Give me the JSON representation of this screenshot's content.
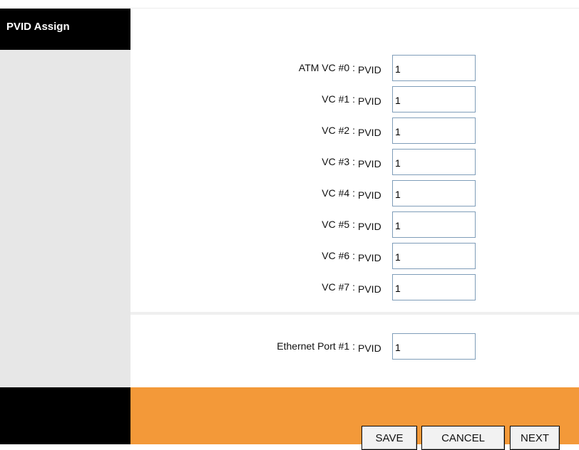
{
  "sidebar": {
    "title": "PVID Assign"
  },
  "vc_rows": [
    {
      "label": "ATM VC #0 :",
      "pvid_label": "PVID",
      "value": "1"
    },
    {
      "label": "VC #1 :",
      "pvid_label": "PVID",
      "value": "1"
    },
    {
      "label": "VC #2 :",
      "pvid_label": "PVID",
      "value": "1"
    },
    {
      "label": "VC #3 :",
      "pvid_label": "PVID",
      "value": "1"
    },
    {
      "label": "VC #4 :",
      "pvid_label": "PVID",
      "value": "1"
    },
    {
      "label": "VC #5 :",
      "pvid_label": "PVID",
      "value": "1"
    },
    {
      "label": "VC #6 :",
      "pvid_label": "PVID",
      "value": "1"
    },
    {
      "label": "VC #7 :",
      "pvid_label": "PVID",
      "value": "1"
    }
  ],
  "ethernet": {
    "label": "Ethernet Port #1 :",
    "pvid_label": "PVID",
    "value": "1"
  },
  "buttons": {
    "save": "SAVE",
    "cancel": "CANCEL",
    "next": "NEXT"
  },
  "colors": {
    "footer_accent": "#f39939",
    "sidebar_bg": "#e7e7e7",
    "header_bg": "#000000"
  }
}
